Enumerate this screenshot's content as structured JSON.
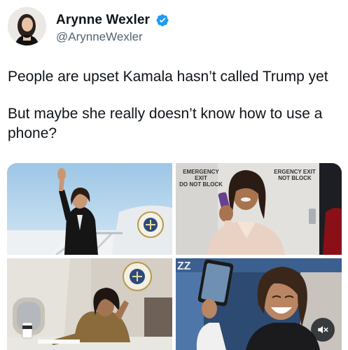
{
  "author": {
    "display_name": "Arynne Wexler",
    "handle": "@ArynneWexler",
    "verified": true,
    "avatar_icon": "profile-photo"
  },
  "tweet": {
    "paragraphs": [
      "People are upset Kamala hasn’t called Trump yet",
      "But maybe she really doesn’t know how to use a phone?"
    ]
  },
  "media": {
    "sign_left": "EMERGENCY EXIT\nDO NOT BLOCK",
    "sign_right": "ERGENCY EXIT\nNOT BLOCK",
    "mute_icon": "speaker-muted-icon"
  },
  "colors": {
    "verified_blue": "#1d9bf0",
    "text_primary": "#0f1419",
    "text_secondary": "#536471"
  }
}
